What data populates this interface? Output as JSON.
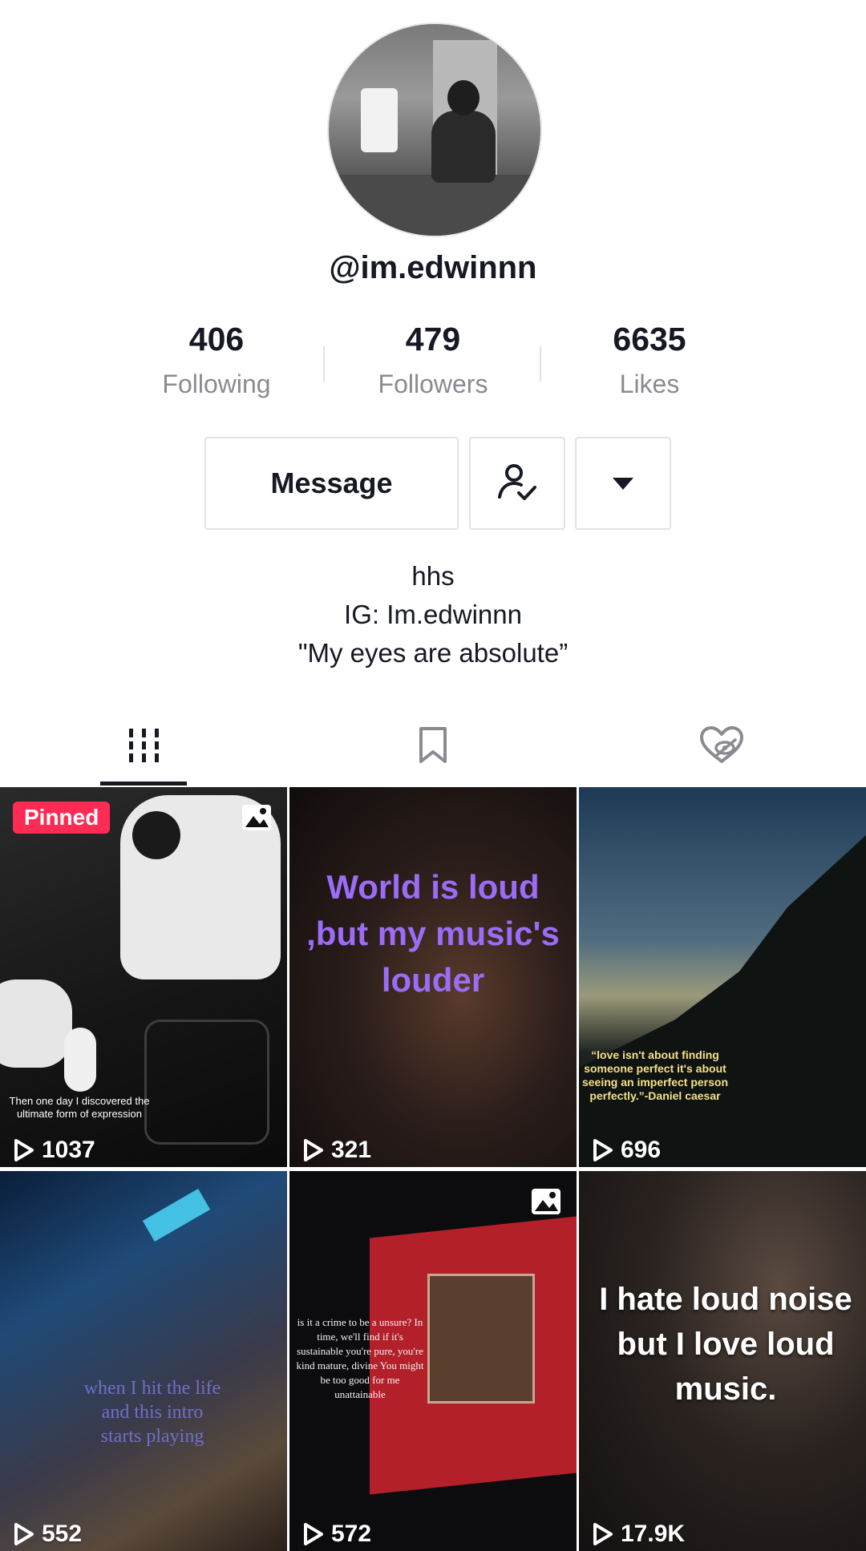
{
  "profile": {
    "username": "@im.edwinnn",
    "stats": [
      {
        "value": "406",
        "label": "Following"
      },
      {
        "value": "479",
        "label": "Followers"
      },
      {
        "value": "6635",
        "label": "Likes"
      }
    ],
    "bio_lines": [
      "hhs",
      "IG: Im.edwinnn",
      "\"My eyes are absolute”"
    ]
  },
  "actions": {
    "message_label": "Message",
    "follow_icon": "user-check-icon",
    "more_icon": "caret-down-icon"
  },
  "tabs": [
    {
      "name": "videos",
      "icon": "grid-icon",
      "active": true
    },
    {
      "name": "saved",
      "icon": "bookmark-icon",
      "active": false
    },
    {
      "name": "liked",
      "icon": "heart-hidden-icon",
      "active": false
    }
  ],
  "videos": [
    {
      "views": "1037",
      "pinned_label": "Pinned",
      "caption": "Then one day I discovered the ultimate form of expression",
      "photo": true
    },
    {
      "views": "321",
      "caption": "World is loud ,but my music's louder",
      "photo": false
    },
    {
      "views": "696",
      "caption": "“love isn't about finding someone perfect it's about seeing an imperfect person perfectly.”-Daniel caesar",
      "photo": false
    },
    {
      "views": "552",
      "caption": "when I hit the life and this intro starts playing",
      "photo": false
    },
    {
      "views": "572",
      "caption": "is it a crime to be a unsure? In time, we'll find if it's sustainable you're pure, you're kind mature, divine You might be too good for me unattainable",
      "photo": true
    },
    {
      "views": "17.9K",
      "caption": "I hate loud noise but I love loud music.",
      "photo": false
    }
  ],
  "colors": {
    "accent": "#fe2c55",
    "text": "#161823",
    "muted": "#8a8b91",
    "purple_caption": "#9b6cf5"
  }
}
